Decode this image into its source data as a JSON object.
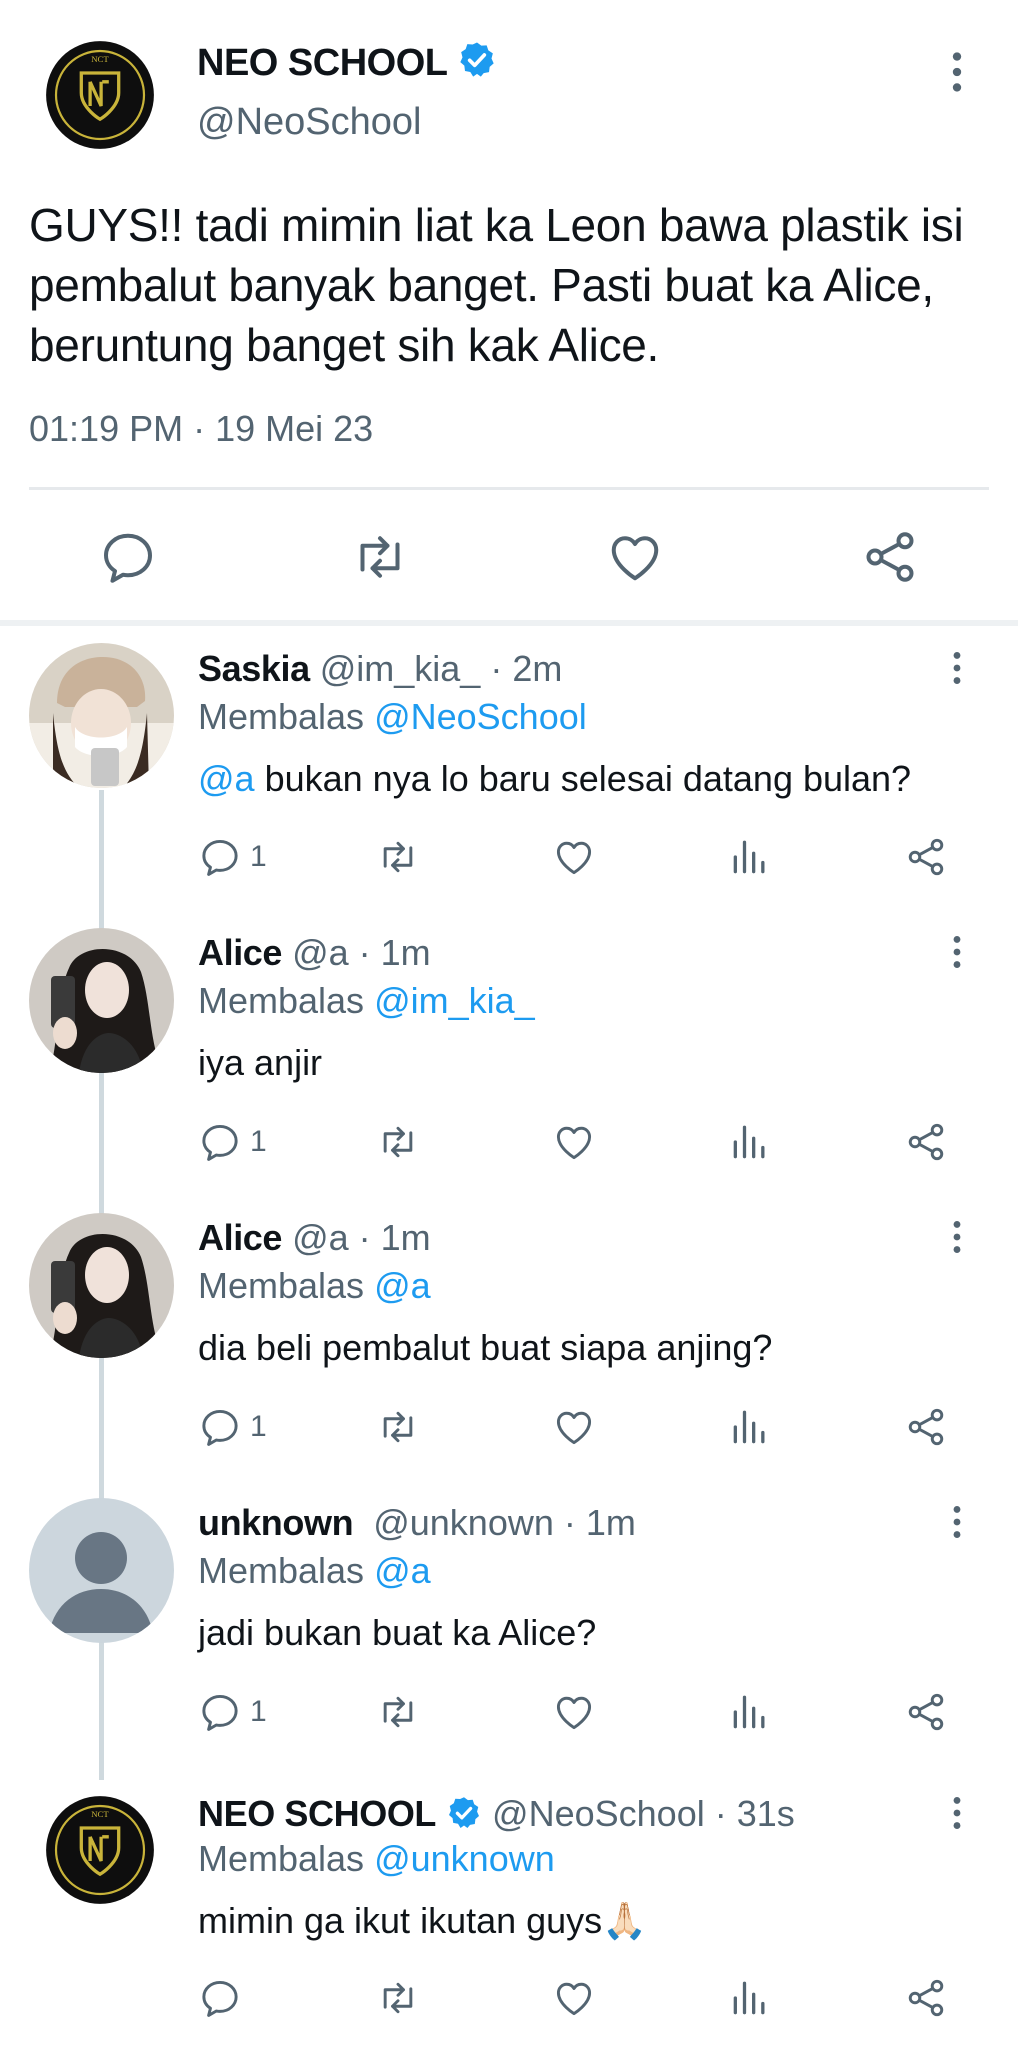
{
  "main_tweet": {
    "name": "NEO SCHOOL",
    "handle": "@NeoSchool",
    "text": "GUYS!! tadi mimin liat ka Leon bawa plastik isi pembalut banyak banget. Pasti buat ka Alice, beruntung banget sih kak Alice.",
    "time": "01:19 PM · 19 Mei 23",
    "avatar_logo_text": "NCT",
    "avatar_ring_text": "NEO CULTURE TECHNOLOGY",
    "actions": [
      "reply-icon",
      "retweet-icon",
      "like-icon",
      "share-icon"
    ]
  },
  "colors": {
    "verified": "#1d9bf0",
    "link": "#1d9bf0",
    "secondary_text": "#536471",
    "icon": "#536471",
    "logo_gold": "#c9b43a"
  },
  "replies": [
    {
      "name": "Saskia",
      "handle": "@im_kia_",
      "time": "· 2m",
      "replying_prefix": "Membalas",
      "replying_to": "@NeoSchool",
      "mention": "@a",
      "text": " bukan nya lo baru selesai datang bulan?",
      "reply_count": "1"
    },
    {
      "name": "Alice",
      "handle": "@a",
      "time": "· 1m",
      "replying_prefix": "Membalas",
      "replying_to": "@im_kia_",
      "text": "iya anjir",
      "reply_count": "1"
    },
    {
      "name": "Alice",
      "handle": "@a",
      "time": "· 1m",
      "replying_prefix": "Membalas",
      "replying_to": "@a",
      "text": "dia beli pembalut buat siapa anjing?",
      "reply_count": "1"
    },
    {
      "name": "unknown",
      "handle": "@unknown",
      "time": "· 1m",
      "replying_prefix": "Membalas",
      "replying_to": "@a",
      "text": "jadi bukan buat ka Alice?",
      "reply_count": "1"
    },
    {
      "name": "NEO SCHOOL",
      "handle": "@NeoSchool",
      "time": "· 31s",
      "replying_prefix": "Membalas",
      "replying_to": "@unknown",
      "text": "mimin ga ikut ikutan guys",
      "emoji": "🙏🏻",
      "reply_count": ""
    }
  ]
}
